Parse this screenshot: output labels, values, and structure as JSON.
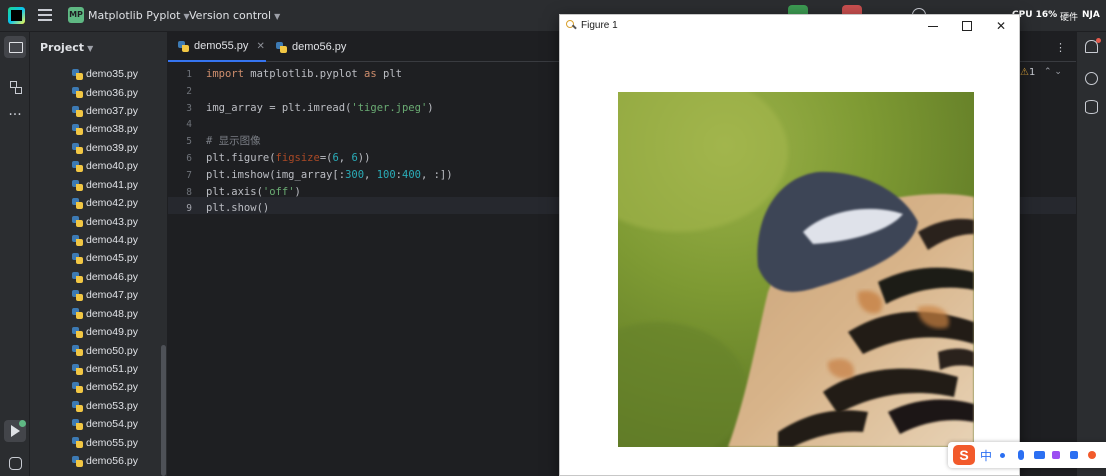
{
  "titlebar": {
    "project_badge": "MP",
    "project_name": "Matplotlib Pyplot",
    "version_control": "Version control",
    "cpu_label": "CPU 16%",
    "hw_label": "硬件",
    "user_label": "NJA"
  },
  "project_panel": {
    "header": "Project",
    "files": [
      "demo35.py",
      "demo36.py",
      "demo37.py",
      "demo38.py",
      "demo39.py",
      "demo40.py",
      "demo41.py",
      "demo42.py",
      "demo43.py",
      "demo44.py",
      "demo45.py",
      "demo46.py",
      "demo47.py",
      "demo48.py",
      "demo49.py",
      "demo50.py",
      "demo51.py",
      "demo52.py",
      "demo53.py",
      "demo54.py",
      "demo55.py",
      "demo56.py"
    ]
  },
  "editor": {
    "tabs": [
      {
        "label": "demo55.py",
        "active": true
      },
      {
        "label": "demo56.py",
        "active": false
      }
    ],
    "warning_count": "1",
    "current_line": 9,
    "lines": [
      {
        "no": "1",
        "text": "import matplotlib.pyplot as plt"
      },
      {
        "no": "2",
        "text": ""
      },
      {
        "no": "3",
        "text": "img_array = plt.imread('tiger.jpeg')"
      },
      {
        "no": "4",
        "text": ""
      },
      {
        "no": "5",
        "text": "# 显示图像"
      },
      {
        "no": "6",
        "text": "plt.figure(figsize=(6, 6))"
      },
      {
        "no": "7",
        "text": "plt.imshow(img_array[:300, 100:400, :])"
      },
      {
        "no": "8",
        "text": "plt.axis('off')"
      },
      {
        "no": "9",
        "text": "plt.show()"
      }
    ]
  },
  "figure_window": {
    "title": "Figure 1",
    "minimize": "minimize",
    "maximize": "maximize",
    "close": "close",
    "image_description": "cropped tiger photo (ear and striped fur on green blurred background)"
  },
  "ime": {
    "logo": "S",
    "lang": "中"
  },
  "colors": {
    "editor_bg": "#1e1f22",
    "panel_bg": "#2b2d30",
    "accent": "#3574f0",
    "keyword": "#cf8e6d",
    "string": "#6aab73",
    "number": "#2aacb8"
  }
}
